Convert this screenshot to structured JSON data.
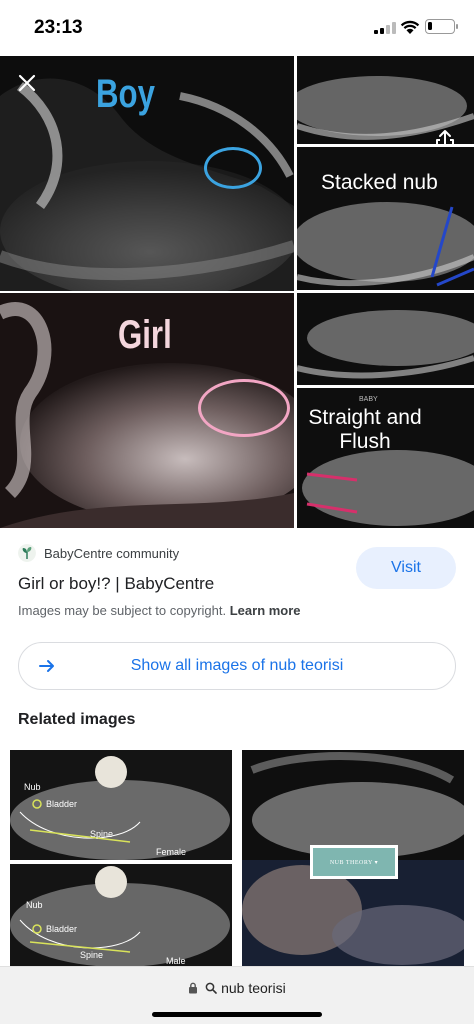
{
  "status": {
    "time": "23:13",
    "battery_level": 0.18
  },
  "hero": {
    "labels": {
      "boy": "Boy",
      "girl": "Girl",
      "stacked_nub": "Stacked nub",
      "baby": "BABY",
      "straight_and_flush": "Straight and\nFlush"
    }
  },
  "result": {
    "source": "BabyCentre community",
    "title": "Girl or boy!? | BabyCentre",
    "visit_label": "Visit",
    "copyright_text": "Images may be subject to copyright.",
    "learn_more": "Learn more",
    "show_all_label": "Show all images of nub teorisi"
  },
  "related": {
    "heading": "Related images",
    "left_labels": {
      "nub_top": "Nub",
      "bladder_top": "Bladder",
      "spine_top": "Spine",
      "female": "Female",
      "nub_bottom": "Nub",
      "bladder_bottom": "Bladder",
      "spine_bottom": "Spine",
      "male": "Male"
    },
    "right_labels": {
      "button_text": "NUB THEORY ▾"
    }
  },
  "url_bar": {
    "query": "nub teorisi"
  },
  "colors": {
    "accent": "#1a73e8",
    "visit_bg": "#e8f0fe",
    "boy_circle": "#3ba3e0",
    "girl_circle": "#f2a6c4",
    "stacked_line": "#2447c9",
    "flush_line": "#d6306b"
  }
}
